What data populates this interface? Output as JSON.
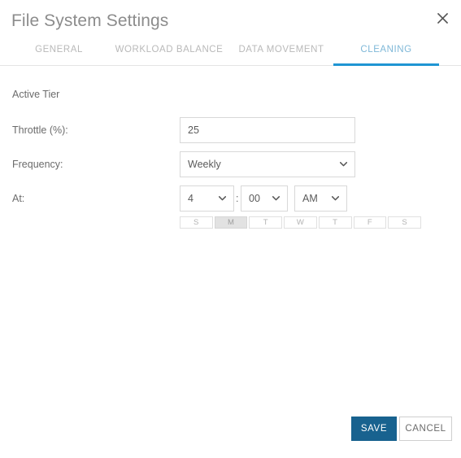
{
  "dialog": {
    "title": "File System Settings",
    "close_icon": "close-icon"
  },
  "tabs": [
    {
      "id": "general",
      "label": "GENERAL",
      "active": false
    },
    {
      "id": "workload",
      "label": "WORKLOAD BALANCE",
      "active": false
    },
    {
      "id": "datamovement",
      "label": "DATA MOVEMENT",
      "active": false
    },
    {
      "id": "cleaning",
      "label": "CLEANING",
      "active": true
    }
  ],
  "form": {
    "section_label": "Active Tier",
    "throttle": {
      "label": "Throttle (%):",
      "value": "25",
      "placeholder": ""
    },
    "frequency": {
      "label": "Frequency:",
      "value": "Weekly",
      "caret_icon": "chevron-down-icon"
    },
    "at": {
      "label": "At:",
      "hour": "4",
      "separator": ":",
      "minute": "00",
      "meridiem": "AM",
      "caret_icon": "chevron-down-icon"
    },
    "days": [
      {
        "label": "S",
        "name": "sunday",
        "selected": false
      },
      {
        "label": "M",
        "name": "monday",
        "selected": true
      },
      {
        "label": "T",
        "name": "tuesday",
        "selected": false
      },
      {
        "label": "W",
        "name": "wednesday",
        "selected": false
      },
      {
        "label": "T",
        "name": "thursday",
        "selected": false
      },
      {
        "label": "F",
        "name": "friday",
        "selected": false
      },
      {
        "label": "S",
        "name": "saturday",
        "selected": false
      }
    ]
  },
  "footer": {
    "save_label": "SAVE",
    "cancel_label": "CANCEL"
  },
  "colors": {
    "accent_blue": "#1f95d3",
    "save_blue": "#18628f",
    "active_tab_text": "#7fb8d8",
    "label_gray": "#6b6b6b",
    "border_gray": "#d8d8d8",
    "day_selected_bg": "#e2e2e2"
  }
}
